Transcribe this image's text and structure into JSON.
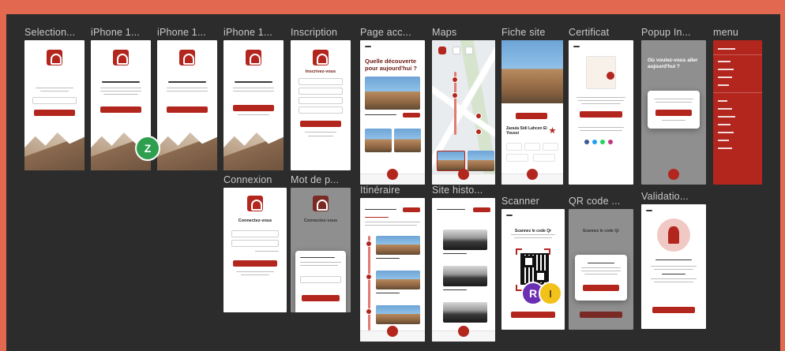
{
  "frames": [
    {
      "id": "selection",
      "label": "Selection..."
    },
    {
      "id": "iphone1",
      "label": "iPhone 1..."
    },
    {
      "id": "iphone2",
      "label": "iPhone 1..."
    },
    {
      "id": "iphone3",
      "label": "iPhone 1..."
    },
    {
      "id": "inscription",
      "label": "Inscription",
      "heading": "Inscrivez-vous"
    },
    {
      "id": "page-accueil",
      "label": "Page acc...",
      "heading": "Quelle découverte pour aujourd'hui ?"
    },
    {
      "id": "maps",
      "label": "Maps"
    },
    {
      "id": "fiche-site",
      "label": "Fiche site",
      "site_name": "Zaouia Sidi Lahcen El Youssi"
    },
    {
      "id": "certificat",
      "label": "Certificat"
    },
    {
      "id": "popup",
      "label": "Popup In...",
      "heading": "Où voulez-vous aller aujourd'hui ?"
    },
    {
      "id": "menu",
      "label": "menu"
    },
    {
      "id": "connexion",
      "label": "Connexion",
      "heading": "Connectez-vous"
    },
    {
      "id": "mot-de-passe",
      "label": "Mot de p...",
      "heading": "Connectez-vous"
    },
    {
      "id": "itineraire",
      "label": "Itinéraire"
    },
    {
      "id": "site-histo",
      "label": "Site histo..."
    },
    {
      "id": "scanner",
      "label": "Scanner",
      "heading": "Scannez le code Qr"
    },
    {
      "id": "qr-code",
      "label": "QR code ...",
      "heading": "Scannez le code Qr"
    },
    {
      "id": "validation",
      "label": "Validatio..."
    }
  ],
  "avatars": [
    {
      "letter": "Z",
      "color": "#2e9e4f"
    },
    {
      "letter": "R",
      "color": "#6a2fb3"
    },
    {
      "letter": "I",
      "color": "#f2c21b"
    }
  ],
  "colors": {
    "accent": "#b3261e",
    "canvas": "#2c2c2c",
    "border": "#e2694f"
  }
}
